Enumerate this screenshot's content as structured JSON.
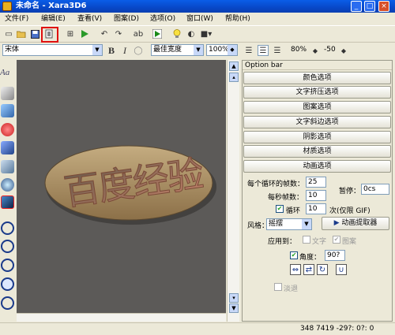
{
  "window": {
    "title": "未命名 - Xara3D6",
    "minimize": "_",
    "maximize": "□",
    "close": "×"
  },
  "menu": [
    "文件(F)",
    "编辑(E)",
    "查看(V)",
    "图案(D)",
    "选项(O)",
    "窗口(W)",
    "帮助(H)"
  ],
  "toolbar2": {
    "font": "宋体",
    "bold": "B",
    "italic": "I",
    "width_mode": "最佳宽度",
    "zoom": "100%",
    "size": "80%",
    "angle": "-50"
  },
  "left_tools": {
    "text_tool": "Aa"
  },
  "canvas": {
    "text": "百度经验"
  },
  "option_bar": {
    "title": "Option bar",
    "buttons": [
      "颜色选项",
      "文字挤压选项",
      "图案选项",
      "文字斜边选项",
      "阴影选项",
      "材质选项",
      "动画选项"
    ],
    "frames_per_loop_label": "每个循环的帧数：",
    "frames_per_loop": "25",
    "frames_per_second_label": "每秒帧数：",
    "frames_per_second": "10",
    "pause_label": "暂停：",
    "pause": "0cs",
    "loop_label": "循环",
    "loop_count": "10",
    "loop_suffix": "次(仅限 GIF)",
    "style_label": "风格：",
    "style": "摇摆",
    "extractor_button": "动画提取器",
    "apply_label": "应用到：",
    "apply_text": "文字",
    "apply_pattern": "图案",
    "angle_label": "角度：",
    "angle": "90?",
    "fade_label": "淡退"
  },
  "status": {
    "coords": "348 7419 -29?: 0?: 0"
  },
  "colors": {
    "title_blue": "#0848c8",
    "canvas_bg": "#5c5a58",
    "highlight_red": "#e01010"
  }
}
